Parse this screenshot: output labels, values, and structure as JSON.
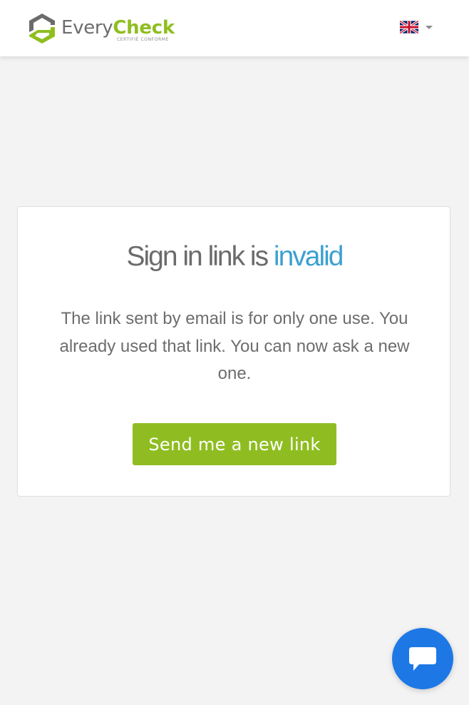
{
  "header": {
    "logo": {
      "name_part1": "Every",
      "name_part2": "Check",
      "tagline": "CERTIFIÉ CONFORME",
      "icon": "everycheck-logo-icon"
    },
    "language": {
      "selected": "English (UK)",
      "icon": "uk-flag-icon",
      "dropdown_icon": "caret-down-icon"
    }
  },
  "main": {
    "title_prefix": "Sign in link is ",
    "title_accent": "invalid",
    "message": "The link sent by email is for only one use. You already used that link. You can now ask a new one.",
    "button_label": "Send me a new link"
  },
  "chat": {
    "icon": "chat-bubble-icon"
  },
  "colors": {
    "background": "#f3f3f3",
    "brand_green": "#8fbd21",
    "accent_blue": "#3da0d0",
    "chat_blue": "#1d78e6",
    "text_gray": "#6d6d6d"
  }
}
